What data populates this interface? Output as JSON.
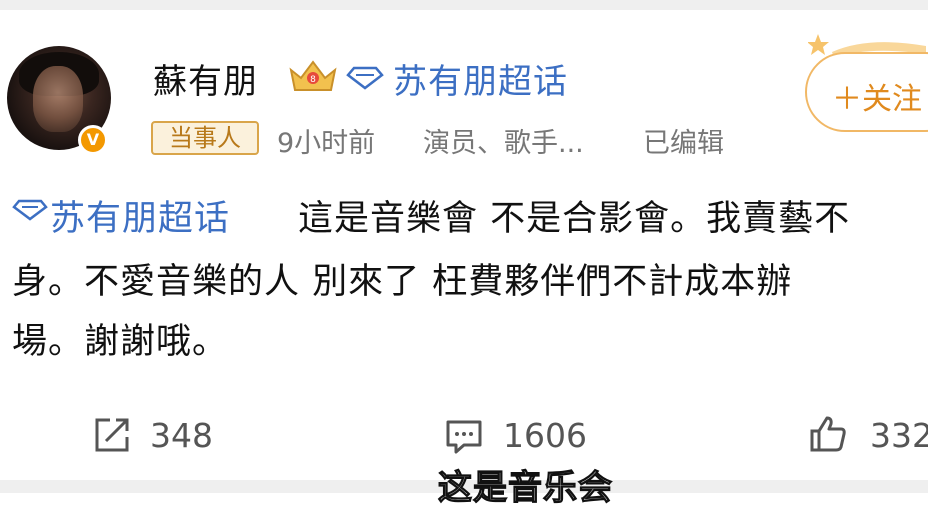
{
  "post": {
    "author_name": "蘇有朋",
    "topic_link": "苏有朋超话",
    "follow_label": "＋关注",
    "tag": "当事人",
    "time": "9小时前",
    "role": "演员、歌手...",
    "edited": "已编辑",
    "body_topic": "苏有朋超话",
    "body_line1": "這是音樂會 不是合影會。我賣藝不",
    "body_line2": "身。不愛音樂的人 別來了 枉費夥伴們不計成本辦",
    "body_line3": "場。謝謝哦。"
  },
  "actions": {
    "reposts": "348",
    "comments": "1606",
    "likes": "332"
  },
  "subtitle": "这是音乐会",
  "colors": {
    "link": "#3c6fc3",
    "accent_orange": "#f39800",
    "tag_text": "#b8791a",
    "meta_gray": "#777777"
  },
  "icons": {
    "verified": "v-badge-icon",
    "crown": "crown-icon",
    "topic": "diamond-topic-icon",
    "repost": "share-icon",
    "comment": "comment-icon",
    "like": "thumbs-up-icon"
  }
}
